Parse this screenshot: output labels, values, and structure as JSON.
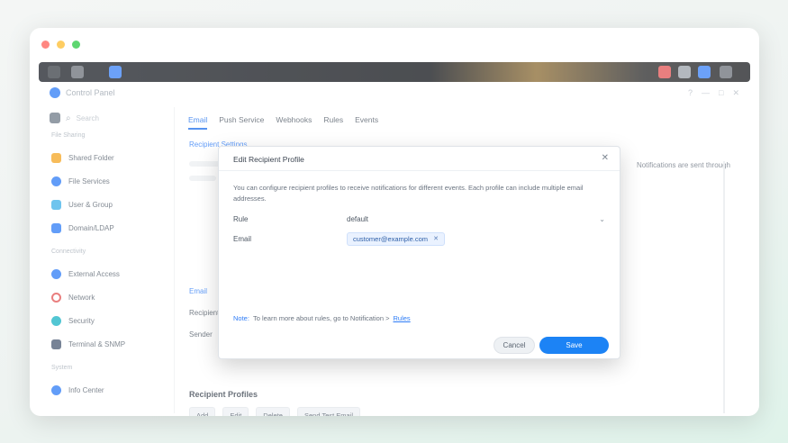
{
  "app": {
    "title": "Control Panel",
    "window_controls": [
      "?",
      "—",
      "□",
      "✕"
    ]
  },
  "colors": {
    "accent": "#1c83f5",
    "window_bg": "#ffffff",
    "taskbar": "#101318"
  },
  "sidebar": {
    "search_placeholder": "Search",
    "groups": [
      {
        "label": "File Sharing",
        "items": [
          {
            "label": "Shared Folder",
            "icon": "folder-icon",
            "color": "#f5a623"
          },
          {
            "label": "File Services",
            "icon": "file-services-icon",
            "color": "#2e7cf6"
          },
          {
            "label": "User & Group",
            "icon": "users-icon",
            "color": "#3fb0e8"
          },
          {
            "label": "Domain/LDAP",
            "icon": "domain-icon",
            "color": "#2e7cf6"
          }
        ]
      },
      {
        "label": "Connectivity",
        "items": [
          {
            "label": "External Access",
            "icon": "globe-icon",
            "color": "#2e7cf6"
          },
          {
            "label": "Network",
            "icon": "network-icon",
            "color": "#e25555"
          },
          {
            "label": "Security",
            "icon": "shield-icon",
            "color": "#19b3c4"
          },
          {
            "label": "Terminal & SNMP",
            "icon": "terminal-icon",
            "color": "#4a5a73"
          }
        ]
      },
      {
        "label": "System",
        "items": [
          {
            "label": "Info Center",
            "icon": "info-icon",
            "color": "#2e7cf6"
          }
        ]
      }
    ]
  },
  "main": {
    "tabs": [
      "Email",
      "Push Service",
      "Webhooks",
      "Rules",
      "Events"
    ],
    "active_tab": "Email",
    "section_link": "Recipient Settings",
    "bg_labels": [
      "Email",
      "Recipient",
      "Sender"
    ],
    "bg_right_text": "Notifications are sent through",
    "response_profiles_title": "Recipient Profiles",
    "profile_buttons": [
      "Add",
      "Edit",
      "Delete",
      "Send Test Email"
    ]
  },
  "dialog": {
    "title": "Edit Recipient Profile",
    "description": "You can configure recipient profiles to receive notifications for different events. Each profile can include multiple email addresses.",
    "fields": [
      {
        "label": "Rule",
        "value": "default",
        "type": "select"
      },
      {
        "label": "Email",
        "value": "customer@example.com",
        "type": "tag"
      }
    ],
    "note_prefix": "Note:",
    "note_text": "To learn more about rules, go to Notification >",
    "note_link": "Rules",
    "cancel_label": "Cancel",
    "apply_label": "Save"
  }
}
